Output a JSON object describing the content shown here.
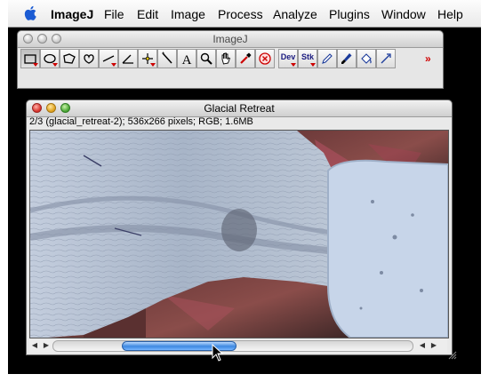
{
  "menubar": {
    "app_name": "ImageJ",
    "items": [
      "File",
      "Edit",
      "Image",
      "Process",
      "Analyze",
      "Plugins",
      "Window",
      "Help"
    ]
  },
  "toolbar_window": {
    "title": "ImageJ",
    "tools": [
      "rectangle-icon",
      "oval-icon",
      "polygon-icon",
      "freehand-icon",
      "line-icon",
      "angle-icon",
      "point-icon",
      "wand-icon",
      "text-icon",
      "magnifier-icon",
      "hand-icon",
      "color-picker-icon",
      "close-circle-icon"
    ],
    "tool_labels": {
      "dev": "Dev",
      "stk": "Stk"
    },
    "more_label": "»"
  },
  "image_window": {
    "title": "Glacial Retreat",
    "info": "2/3 (glacial_retreat-2); 536x266 pixels; RGB; 1.6MB",
    "scroll": {
      "thumb_start_fraction": 0.19,
      "thumb_length_fraction": 0.32
    }
  },
  "colors": {
    "menubar_bg": "#eeeeee",
    "scroll_thumb": "#3d88e0",
    "close_button": "#d8332b",
    "minimize_button": "#e0a21e",
    "zoom_button": "#4aa635"
  }
}
